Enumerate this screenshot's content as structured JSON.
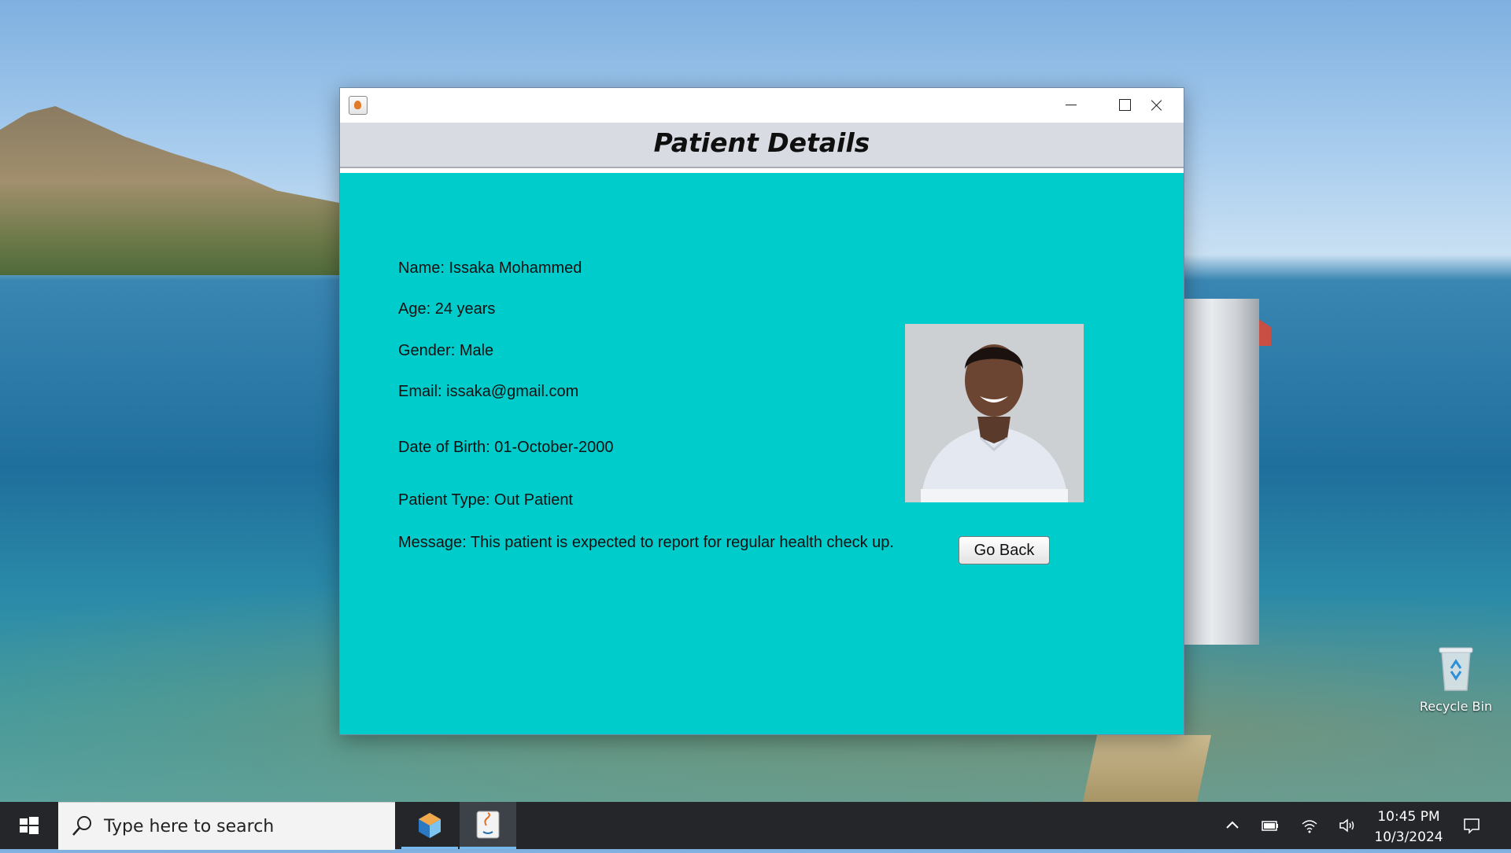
{
  "window": {
    "title": "",
    "header_title": "Patient Details",
    "minimize_label": "",
    "maximize_label": "",
    "close_label": ""
  },
  "patient": {
    "name": "Name: Issaka Mohammed",
    "age": "Age: 24 years",
    "gender": "Gender: Male",
    "email": "Email: issaka@gmail.com",
    "dob": "Date of Birth: 01-October-2000",
    "type": "Patient Type: Out Patient",
    "message": "Message: This patient is expected to report for regular health check up."
  },
  "actions": {
    "go_back": "Go Back"
  },
  "desktop": {
    "recycle_bin": "Recycle Bin"
  },
  "taskbar": {
    "search_placeholder": "Type here to search",
    "time": "10:45 PM",
    "date": "10/3/2024",
    "apps": [
      {
        "icon": "netbeans-icon",
        "active": false
      },
      {
        "icon": "java-icon",
        "active": true
      }
    ]
  },
  "colors": {
    "content_background": "#00cccc",
    "header_background": "#d8dbe1",
    "taskbar_background": "#24262a"
  }
}
